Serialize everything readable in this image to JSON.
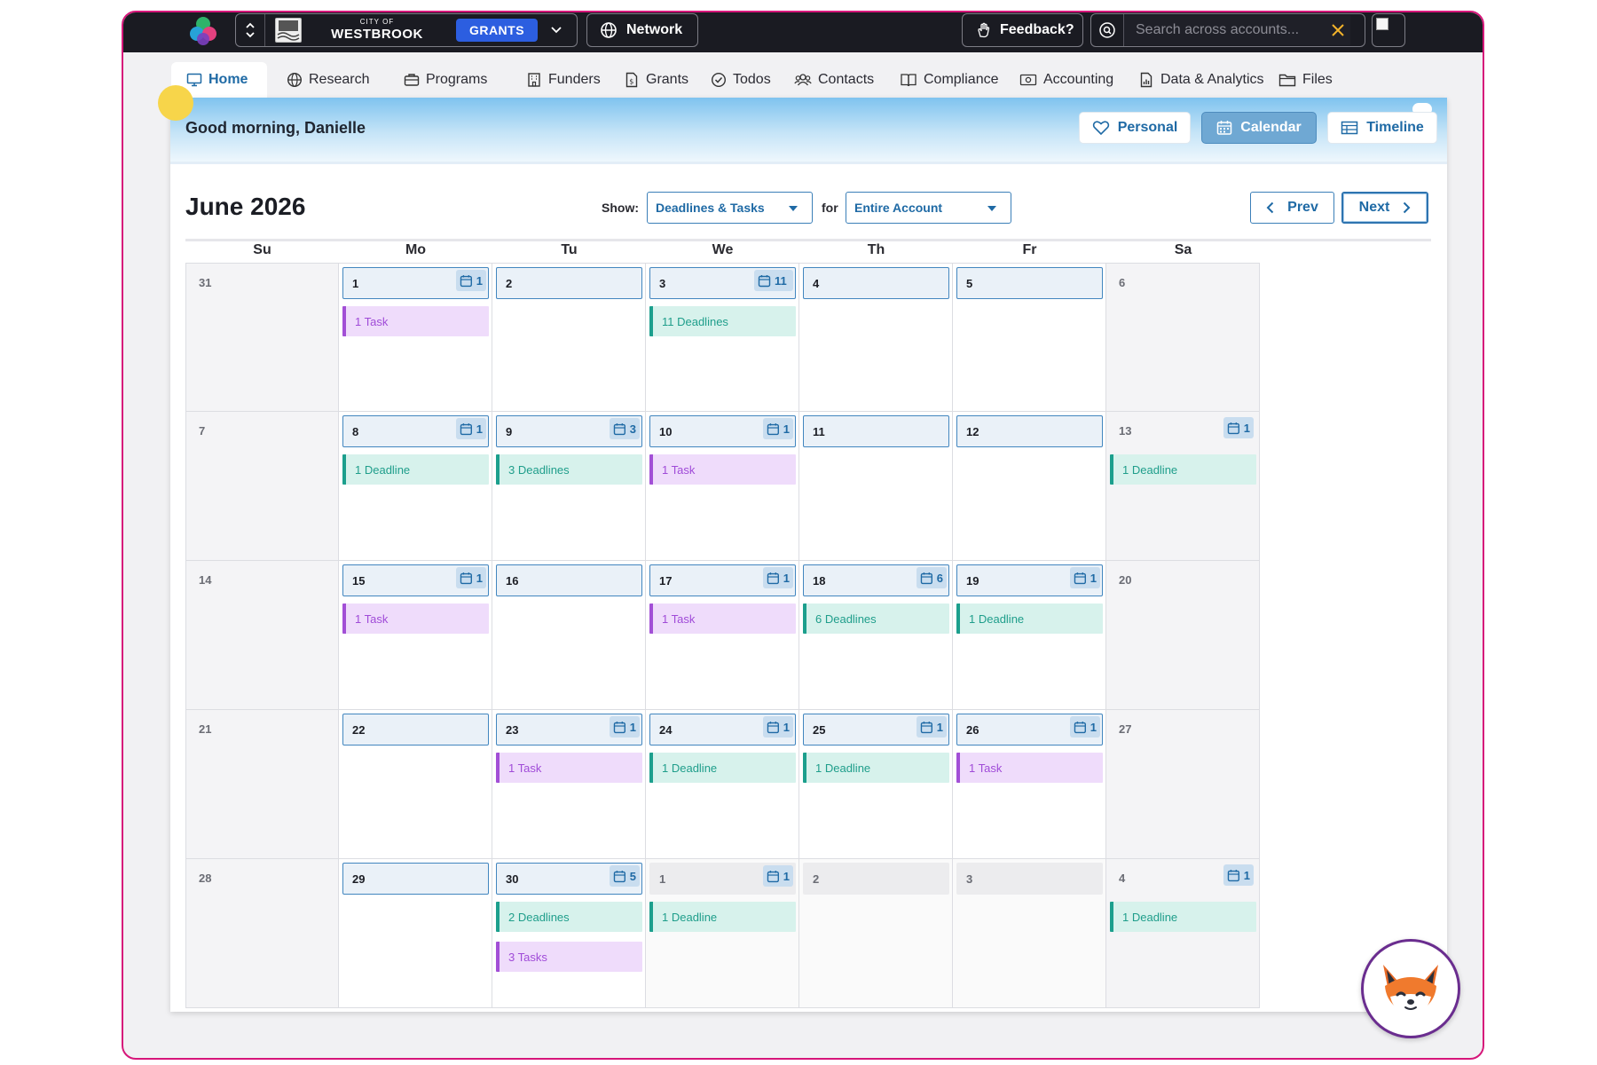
{
  "topbar": {
    "city_small": "CITY OF",
    "city_name": "WESTBROOK",
    "module_badge": "GRANTS",
    "network_label": "Network",
    "feedback_label": "Feedback?",
    "search_placeholder": "Search across accounts..."
  },
  "nav": {
    "tabs": [
      {
        "label": "Home",
        "icon": "monitor-icon",
        "active": true
      },
      {
        "label": "Research",
        "icon": "globe-icon"
      },
      {
        "label": "Programs",
        "icon": "briefcase-icon"
      },
      {
        "label": "Funders",
        "icon": "building-icon"
      },
      {
        "label": "Grants",
        "icon": "dollar-doc-icon"
      },
      {
        "label": "Todos",
        "icon": "check-circle-icon"
      },
      {
        "label": "Contacts",
        "icon": "people-icon"
      },
      {
        "label": "Compliance",
        "icon": "book-icon"
      },
      {
        "label": "Accounting",
        "icon": "money-icon"
      },
      {
        "label": "Data & Analytics",
        "icon": "chart-doc-icon"
      },
      {
        "label": "Files",
        "icon": "folder-icon"
      }
    ]
  },
  "banner": {
    "greeting": "Good morning, Danielle",
    "views": {
      "personal": "Personal",
      "calendar": "Calendar",
      "timeline": "Timeline"
    },
    "active_view": "Calendar"
  },
  "calendar": {
    "month_title": "June 2026",
    "show_label": "Show:",
    "show_value": "Deadlines & Tasks",
    "for_label": "for",
    "for_value": "Entire Account",
    "prev_label": "Prev",
    "next_label": "Next",
    "day_headers": [
      "Su",
      "Mo",
      "Tu",
      "We",
      "Th",
      "Fr",
      "Sa"
    ],
    "weeks": [
      [
        {
          "day": "31",
          "kind": "plain"
        },
        {
          "day": "1",
          "kind": "box",
          "badge": "1",
          "events": [
            {
              "type": "task",
              "label": "1 Task"
            }
          ]
        },
        {
          "day": "2",
          "kind": "box",
          "events": []
        },
        {
          "day": "3",
          "kind": "box",
          "badge": "11",
          "events": [
            {
              "type": "deadline",
              "label": "11 Deadlines"
            }
          ]
        },
        {
          "day": "4",
          "kind": "box",
          "events": []
        },
        {
          "day": "5",
          "kind": "box",
          "events": []
        },
        {
          "day": "6",
          "kind": "plain"
        }
      ],
      [
        {
          "day": "7",
          "kind": "plain"
        },
        {
          "day": "8",
          "kind": "box",
          "badge": "1",
          "events": [
            {
              "type": "deadline",
              "label": "1 Deadline"
            }
          ]
        },
        {
          "day": "9",
          "kind": "box",
          "badge": "3",
          "events": [
            {
              "type": "deadline",
              "label": "3 Deadlines"
            }
          ]
        },
        {
          "day": "10",
          "kind": "box",
          "badge": "1",
          "events": [
            {
              "type": "task",
              "label": "1 Task"
            }
          ]
        },
        {
          "day": "11",
          "kind": "box",
          "events": []
        },
        {
          "day": "12",
          "kind": "box",
          "events": []
        },
        {
          "day": "13",
          "kind": "plain",
          "badge": "1",
          "events": [
            {
              "type": "deadline",
              "label": "1 Deadline"
            }
          ]
        }
      ],
      [
        {
          "day": "14",
          "kind": "plain"
        },
        {
          "day": "15",
          "kind": "box",
          "badge": "1",
          "events": [
            {
              "type": "task",
              "label": "1 Task"
            }
          ]
        },
        {
          "day": "16",
          "kind": "box",
          "events": []
        },
        {
          "day": "17",
          "kind": "box",
          "badge": "1",
          "events": [
            {
              "type": "task",
              "label": "1 Task"
            }
          ]
        },
        {
          "day": "18",
          "kind": "box",
          "badge": "6",
          "events": [
            {
              "type": "deadline",
              "label": "6 Deadlines"
            }
          ]
        },
        {
          "day": "19",
          "kind": "box",
          "badge": "1",
          "events": [
            {
              "type": "deadline",
              "label": "1 Deadline"
            }
          ]
        },
        {
          "day": "20",
          "kind": "plain"
        }
      ],
      [
        {
          "day": "21",
          "kind": "plain"
        },
        {
          "day": "22",
          "kind": "box",
          "events": []
        },
        {
          "day": "23",
          "kind": "box",
          "badge": "1",
          "events": [
            {
              "type": "task",
              "label": "1 Task"
            }
          ]
        },
        {
          "day": "24",
          "kind": "box",
          "badge": "1",
          "events": [
            {
              "type": "deadline",
              "label": "1 Deadline"
            }
          ]
        },
        {
          "day": "25",
          "kind": "box",
          "badge": "1",
          "events": [
            {
              "type": "deadline",
              "label": "1 Deadline"
            }
          ]
        },
        {
          "day": "26",
          "kind": "box",
          "badge": "1",
          "events": [
            {
              "type": "task",
              "label": "1 Task"
            }
          ]
        },
        {
          "day": "27",
          "kind": "plain"
        }
      ],
      [
        {
          "day": "28",
          "kind": "plain"
        },
        {
          "day": "29",
          "kind": "box",
          "events": []
        },
        {
          "day": "30",
          "kind": "box",
          "badge": "5",
          "events": [
            {
              "type": "deadline",
              "label": "2 Deadlines"
            },
            {
              "type": "task",
              "label": "3 Tasks"
            }
          ]
        },
        {
          "day": "1",
          "kind": "outside",
          "badge": "1",
          "events": [
            {
              "type": "deadline",
              "label": "1 Deadline"
            }
          ]
        },
        {
          "day": "2",
          "kind": "outside",
          "events": []
        },
        {
          "day": "3",
          "kind": "outside",
          "events": []
        },
        {
          "day": "4",
          "kind": "plain",
          "badge": "1",
          "events": [
            {
              "type": "deadline",
              "label": "1 Deadline"
            }
          ]
        }
      ]
    ]
  },
  "colors": {
    "accent": "#1f6aa5",
    "task": "#a24fd6",
    "deadline": "#1c9f8d",
    "frame": "#d6177a",
    "topbar": "#1a1b22"
  },
  "assistant": {
    "icon": "fox-mascot-icon"
  }
}
